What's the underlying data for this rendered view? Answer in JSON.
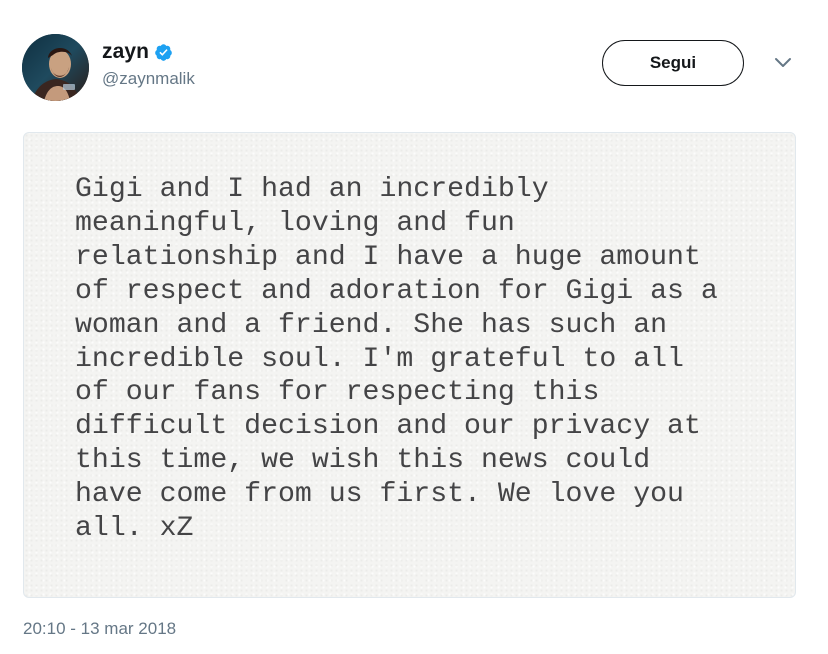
{
  "author": {
    "display_name": "zayn",
    "handle": "@zaynmalik",
    "verified": true,
    "avatar_icon": "profile-photo"
  },
  "actions": {
    "follow_label": "Segui",
    "menu_icon": "chevron-down-icon"
  },
  "media": {
    "lines": [
      "Gigi and I had an incredibly",
      "meaningful, loving and fun",
      "relationship and I have a huge amount",
      "of respect and adoration for Gigi as a",
      "woman and a friend. She has such an",
      "incredible soul. I'm grateful to all",
      "of our fans for respecting this",
      "difficult decision and our privacy at",
      "this time, we wish this news could",
      "have come from us first. We love you",
      "all. xZ"
    ]
  },
  "meta": {
    "timestamp": "20:10 - 13 mar 2018"
  },
  "colors": {
    "verified_blue": "#1da1f2",
    "secondary_text": "#657786",
    "note_text": "#444446",
    "paper": "#f4f4f2"
  }
}
